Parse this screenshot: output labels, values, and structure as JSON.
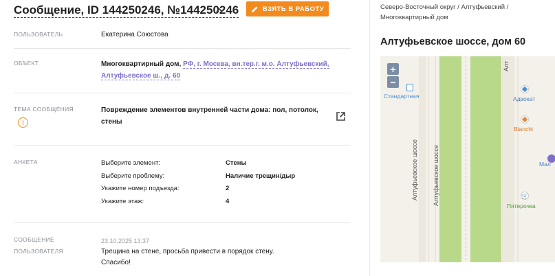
{
  "header": {
    "title": "Сообщение, ID 144250246, №144250246",
    "work_button": "ВЗЯТЬ В РАБОТУ"
  },
  "fields": {
    "user": {
      "label": "ПОЛЬЗОВАТЕЛЬ",
      "value": "Екатерина Союстова"
    },
    "object": {
      "label": "ОБЪЕКТ",
      "type": "Многоквартирный дом,",
      "address_line1": "РФ, г. Москва, вн.тер.г. м.о. Алтуфьевский,",
      "address_line2": "Алтуфьевское ш., д. 60"
    },
    "topic": {
      "label": "ТЕМА СООБЩЕНИЯ",
      "value_line1": "Повреждение элементов внутренней части дома: пол, потолок,",
      "value_line2": "стены"
    },
    "survey": {
      "label": "АНКЕТА",
      "rows": [
        {
          "q": "Выберите элемент:",
          "a": "Стены"
        },
        {
          "q": "Выберите проблему:",
          "a": "Наличие трещин/дыр"
        },
        {
          "q": "Укажите номер подъезда:",
          "a": "2"
        },
        {
          "q": "Укажите этаж:",
          "a": "4"
        }
      ]
    },
    "message": {
      "label_line1": "СООБЩЕНИЕ",
      "label_line2": "ПОЛЬЗОВАТЕЛЯ",
      "date": "23.10.2025 13:37",
      "text_line1": "Трещина на стене, просьба привести в порядок стену.",
      "text_line2": "Спасибо!"
    }
  },
  "sidebar": {
    "breadcrumb_line1": "Северо-Восточный округ / Алтуфьевский /",
    "breadcrumb_line2": "Многоквартирный дом",
    "address_title": "Алтуфьевское шоссе, дом 60"
  },
  "map": {
    "zoom_in": "+",
    "zoom_out": "−",
    "labels": {
      "metro": "Стандартная",
      "road1": "Алтуфьевское шоссе",
      "road2": "Алтуфьевское шоссе",
      "poi_lawyer": "Адвокат",
      "poi_bianchi": "Bianchi",
      "poi_shop": "Пятерочка",
      "poi_cut": "Мал"
    }
  },
  "colors": {
    "accent": "#f28a1d",
    "link": "#7e6fc9",
    "label": "#8a8f99",
    "park": "#b9d98a"
  }
}
